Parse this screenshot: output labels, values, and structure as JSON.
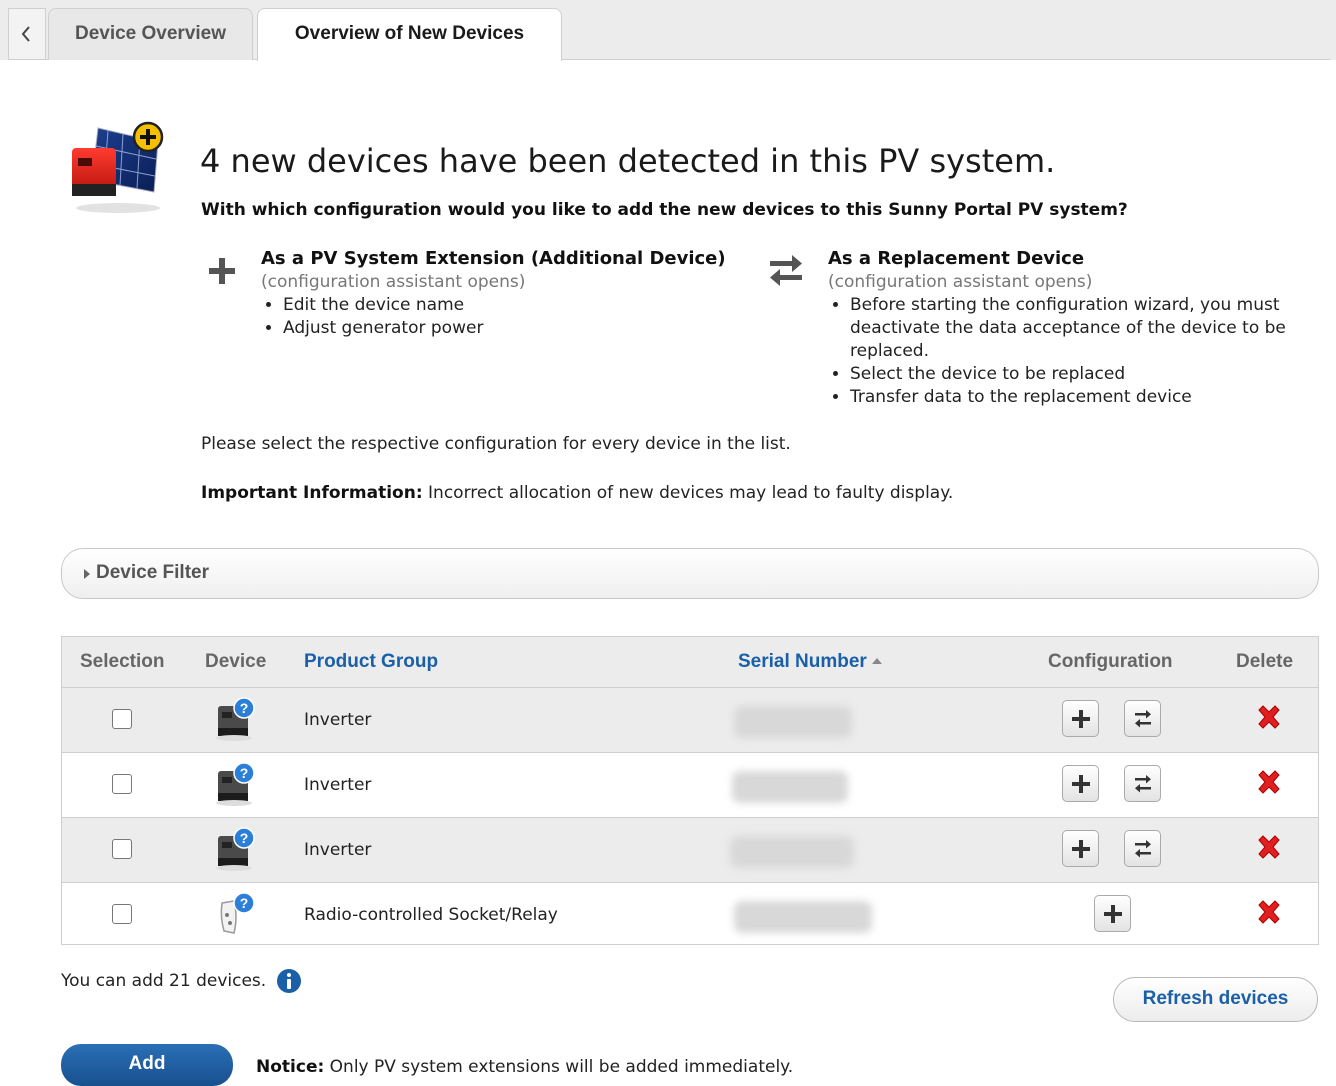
{
  "tabs": {
    "back_icon": "chevron-left-icon",
    "items": [
      {
        "label": "Device Overview",
        "active": false
      },
      {
        "label": "Overview of New Devices",
        "active": true
      }
    ]
  },
  "header": {
    "title": "4 new devices have been detected in this PV system.",
    "question": "With which configuration would you like to add the new devices to this Sunny Portal PV system?"
  },
  "options": {
    "extension": {
      "icon": "plus-icon",
      "title": "As a PV System Extension (Additional Device)",
      "subtitle": "(configuration assistant opens)",
      "bullets": [
        "Edit the device name",
        "Adjust generator power"
      ]
    },
    "replacement": {
      "icon": "swap-arrows-icon",
      "title": "As a Replacement Device",
      "subtitle": "(configuration assistant opens)",
      "bullets": [
        "Before starting the configuration wizard, you must deactivate the data acceptance of the device to be replaced.",
        "Select the device to be replaced",
        "Transfer data to the replacement device"
      ]
    }
  },
  "instructions": {
    "select_note": "Please select the respective configuration for every device in the list.",
    "important_label": "Important Information:",
    "important_text": " Incorrect allocation of new devices may lead to faulty display."
  },
  "filter": {
    "label": "Device Filter"
  },
  "table": {
    "headers": {
      "selection": "Selection",
      "device": "Device",
      "product_group": "Product Group",
      "serial_number": "Serial Number",
      "configuration": "Configuration",
      "delete": "Delete"
    },
    "sort": {
      "column": "serial_number",
      "direction": "ascending"
    },
    "rows": [
      {
        "product_group": "Inverter",
        "device_icon": "inverter-unknown-icon",
        "checked": false,
        "can_replace": true
      },
      {
        "product_group": "Inverter",
        "device_icon": "inverter-unknown-icon",
        "checked": false,
        "can_replace": true
      },
      {
        "product_group": "Inverter",
        "device_icon": "inverter-unknown-icon",
        "checked": false,
        "can_replace": true
      },
      {
        "product_group": "Radio-controlled Socket/Relay",
        "device_icon": "socket-relay-unknown-icon",
        "checked": false,
        "can_replace": false
      }
    ]
  },
  "footer": {
    "can_add": "You can add 21 devices.",
    "refresh_label": "Refresh devices",
    "add_label": "Add",
    "notice_label": "Notice:",
    "notice_text": " Only PV system extensions will be added immediately."
  },
  "colors": {
    "link": "#1b5fa8",
    "primary_button": "#1f5ea2",
    "delete": "#e02020",
    "row_alt": "#ececec"
  }
}
